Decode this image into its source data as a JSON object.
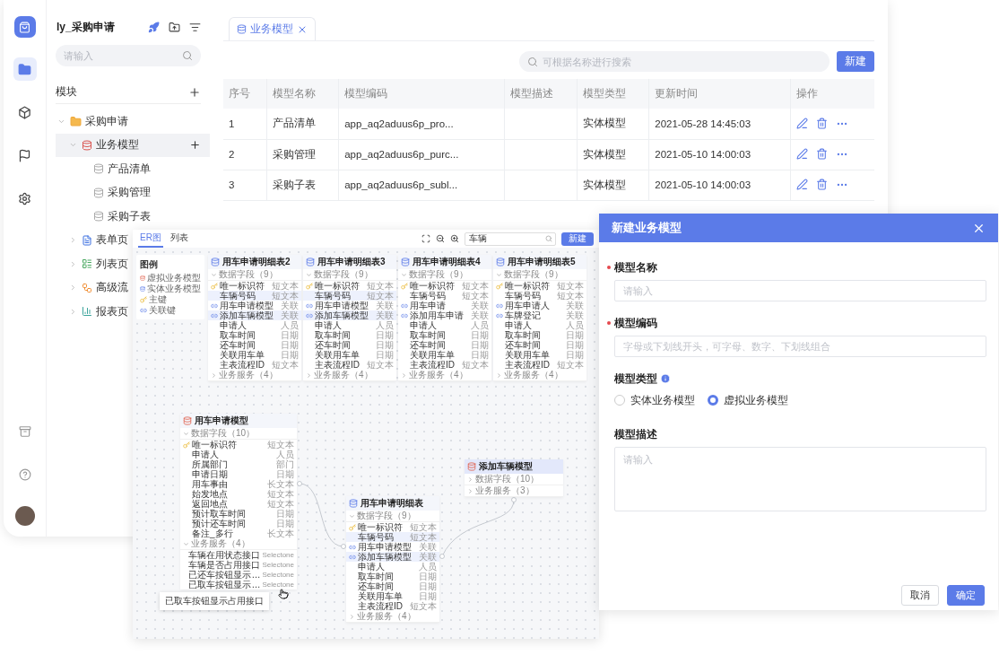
{
  "app_window": {
    "rail": {
      "items": [
        {
          "selected": true
        },
        {
          "selected": false
        },
        {
          "selected": false
        },
        {
          "selected": false
        }
      ]
    },
    "project_title": "ly_采购申请",
    "sidebar_search": {
      "placeholder": "请输入"
    },
    "module_header": "模块",
    "tree": [
      {
        "label": "采购申请",
        "kind": "folder",
        "selected": false,
        "expanded": true,
        "children": [
          {
            "label": "业务模型",
            "kind": "model",
            "selected": true,
            "expanded": true,
            "children": [
              {
                "label": "产品清单",
                "kind": "table",
                "selected": false
              },
              {
                "label": "采购管理",
                "kind": "table",
                "selected": false
              },
              {
                "label": "采购子表",
                "kind": "table",
                "selected": false
              }
            ]
          },
          {
            "label": "表单页",
            "kind": "form",
            "selected": false,
            "expanded": false
          },
          {
            "label": "列表页",
            "kind": "list",
            "selected": false,
            "expanded": false
          },
          {
            "label": "高级流",
            "kind": "flow",
            "selected": false,
            "expanded": false
          },
          {
            "label": "报表页",
            "kind": "report",
            "selected": false,
            "expanded": false
          }
        ]
      }
    ],
    "tabs": [
      {
        "label": "业务模型",
        "selected": true,
        "closable": true
      }
    ],
    "table_search": {
      "placeholder": "可根据名称进行搜索"
    },
    "new_button": "新建",
    "table": {
      "columns": [
        "序号",
        "模型名称",
        "模型编码",
        "模型描述",
        "模型类型",
        "更新时间",
        "操作"
      ],
      "rows": [
        {
          "index": "1",
          "name": "产品清单",
          "code": "app_aq2aduus6p_pro...",
          "type": "实体模型",
          "updated": "2021-05-28 14:45:03"
        },
        {
          "index": "2",
          "name": "采购管理",
          "code": "app_aq2aduus6p_purc...",
          "type": "实体模型",
          "updated": "2021-05-10 14:00:03"
        },
        {
          "index": "3",
          "name": "采购子表",
          "code": "app_aq2aduus6p_subl...",
          "type": "实体模型",
          "updated": "2021-05-10 14:00:03"
        }
      ]
    }
  },
  "er_window": {
    "tabs": [
      {
        "label": "ER图",
        "selected": true
      },
      {
        "label": "列表",
        "selected": false
      }
    ],
    "search": {
      "value": "车辆"
    },
    "new_button": "新建",
    "legend": {
      "title": "图例",
      "items": [
        {
          "label": "虚拟业务模型",
          "kind": "virtual"
        },
        {
          "label": "实体业务模型",
          "kind": "entity"
        },
        {
          "label": "主键",
          "kind": "key"
        },
        {
          "label": "关联键",
          "kind": "link"
        }
      ]
    },
    "entities": [
      {
        "name": "用车申请明细表2",
        "kind": "entity",
        "selected": false,
        "fields": {
          "label": "数据字段（9）",
          "expanded": true,
          "items": [
            {
              "name": "唯一标识符",
              "type": "短文本",
              "kind": "key",
              "highlighted": false
            },
            {
              "name": "车辆号码",
              "type": "短文本",
              "kind": "plain",
              "highlighted": true
            },
            {
              "name": "用车申请模型",
              "type": "关联",
              "kind": "link",
              "highlighted": false
            },
            {
              "name": "添加车辆模型",
              "type": "关联",
              "kind": "link",
              "highlighted": true
            },
            {
              "name": "申请人",
              "type": "人员",
              "kind": "plain",
              "highlighted": false
            },
            {
              "name": "取车时间",
              "type": "日期",
              "kind": "plain",
              "highlighted": false
            },
            {
              "name": "还车时间",
              "type": "日期",
              "kind": "plain",
              "highlighted": false
            },
            {
              "name": "关联用车单",
              "type": "日期",
              "kind": "plain",
              "highlighted": false
            },
            {
              "name": "主表流程ID",
              "type": "短文本",
              "kind": "plain",
              "highlighted": false
            }
          ]
        },
        "services": {
          "label": "业务服务（4）",
          "expanded": false
        }
      },
      {
        "name": "用车申请明细表3",
        "kind": "entity",
        "selected": false,
        "fields": {
          "label": "数据字段（9）",
          "expanded": true,
          "items": [
            {
              "name": "唯一标识符",
              "type": "短文本",
              "kind": "key",
              "highlighted": false
            },
            {
              "name": "车辆号码",
              "type": "短文本",
              "kind": "plain",
              "highlighted": true
            },
            {
              "name": "用车申请模型",
              "type": "关联",
              "kind": "link",
              "highlighted": false
            },
            {
              "name": "添加车辆模型",
              "type": "关联",
              "kind": "link",
              "highlighted": true
            },
            {
              "name": "申请人",
              "type": "人员",
              "kind": "plain",
              "highlighted": false
            },
            {
              "name": "取车时间",
              "type": "日期",
              "kind": "plain",
              "highlighted": false
            },
            {
              "name": "还车时间",
              "type": "日期",
              "kind": "plain",
              "highlighted": false
            },
            {
              "name": "关联用车单",
              "type": "日期",
              "kind": "plain",
              "highlighted": false
            },
            {
              "name": "主表流程ID",
              "type": "短文本",
              "kind": "plain",
              "highlighted": false
            }
          ]
        },
        "services": {
          "label": "业务服务（4）",
          "expanded": false
        }
      },
      {
        "name": "用车申请明细表4",
        "kind": "entity",
        "selected": false,
        "fields": {
          "label": "数据字段（9）",
          "expanded": true,
          "items": [
            {
              "name": "唯一标识符",
              "type": "短文本",
              "kind": "key",
              "highlighted": false
            },
            {
              "name": "车辆号码",
              "type": "短文本",
              "kind": "plain",
              "highlighted": false
            },
            {
              "name": "用车申请",
              "type": "关联",
              "kind": "link",
              "highlighted": false
            },
            {
              "name": "添加用车申请",
              "type": "关联",
              "kind": "link",
              "highlighted": false
            },
            {
              "name": "申请人",
              "type": "人员",
              "kind": "plain",
              "highlighted": false
            },
            {
              "name": "取车时间",
              "type": "日期",
              "kind": "plain",
              "highlighted": false
            },
            {
              "name": "还车时间",
              "type": "日期",
              "kind": "plain",
              "highlighted": false
            },
            {
              "name": "关联用车单",
              "type": "日期",
              "kind": "plain",
              "highlighted": false
            },
            {
              "name": "主表流程ID",
              "type": "短文本",
              "kind": "plain",
              "highlighted": false
            }
          ]
        },
        "services": {
          "label": "业务服务（4）",
          "expanded": false
        }
      },
      {
        "name": "用车申请明细表5",
        "kind": "entity",
        "selected": false,
        "fields": {
          "label": "数据字段（9）",
          "expanded": true,
          "items": [
            {
              "name": "唯一标识符",
              "type": "短文本",
              "kind": "key",
              "highlighted": false
            },
            {
              "name": "车辆号码",
              "type": "短文本",
              "kind": "plain",
              "highlighted": false
            },
            {
              "name": "用车申请人",
              "type": "关联",
              "kind": "link",
              "highlighted": false
            },
            {
              "name": "车牌登记",
              "type": "关联",
              "kind": "link",
              "highlighted": false
            },
            {
              "name": "申请人",
              "type": "人员",
              "kind": "plain",
              "highlighted": false
            },
            {
              "name": "取车时间",
              "type": "日期",
              "kind": "plain",
              "highlighted": false
            },
            {
              "name": "还车时间",
              "type": "日期",
              "kind": "plain",
              "highlighted": false
            },
            {
              "name": "关联用车单",
              "type": "日期",
              "kind": "plain",
              "highlighted": false
            },
            {
              "name": "主表流程ID",
              "type": "短文本",
              "kind": "plain",
              "highlighted": false
            }
          ]
        },
        "services": {
          "label": "业务服务（4）",
          "expanded": false
        }
      },
      {
        "name": "用车申请模型",
        "kind": "virtual",
        "selected": false,
        "fields": {
          "label": "数据字段（10）",
          "expanded": true,
          "items": [
            {
              "name": "唯一标识符",
              "type": "短文本",
              "kind": "key",
              "highlighted": false
            },
            {
              "name": "申请人",
              "type": "人员",
              "kind": "plain",
              "highlighted": false
            },
            {
              "name": "所属部门",
              "type": "部门",
              "kind": "plain",
              "highlighted": false
            },
            {
              "name": "申请日期",
              "type": "日期",
              "kind": "plain",
              "highlighted": false
            },
            {
              "name": "用车事由",
              "type": "长文本",
              "kind": "plain",
              "highlighted": false
            },
            {
              "name": "始发地点",
              "type": "短文本",
              "kind": "plain",
              "highlighted": false
            },
            {
              "name": "返回地点",
              "type": "短文本",
              "kind": "plain",
              "highlighted": false
            },
            {
              "name": "预计取车时间",
              "type": "日期",
              "kind": "plain",
              "highlighted": false
            },
            {
              "name": "预计还车时间",
              "type": "日期",
              "kind": "plain",
              "highlighted": false
            },
            {
              "name": "备注_多行",
              "type": "长文本",
              "kind": "plain",
              "highlighted": false
            }
          ]
        },
        "services": {
          "label": "业务服务（4）",
          "expanded": true,
          "items": [
            {
              "name": "车辆在用状态接口",
              "type": "Selectone"
            },
            {
              "name": "车辆是否占用接口",
              "type": "Selectone"
            },
            {
              "name": "已还车按钮显示…",
              "type": "Selectone"
            },
            {
              "name": "已取车按钮显示…",
              "type": "Selectone"
            }
          ]
        }
      },
      {
        "name": "用车申请明细表",
        "kind": "entity",
        "selected": false,
        "fields": {
          "label": "数据字段（9）",
          "expanded": true,
          "items": [
            {
              "name": "唯一标识符",
              "type": "短文本",
              "kind": "key",
              "highlighted": false
            },
            {
              "name": "车辆号码",
              "type": "短文本",
              "kind": "plain",
              "highlighted": true
            },
            {
              "name": "用车申请模型",
              "type": "关联",
              "kind": "link",
              "highlighted": false
            },
            {
              "name": "添加车辆模型",
              "type": "关联",
              "kind": "link",
              "highlighted": true
            },
            {
              "name": "申请人",
              "type": "人员",
              "kind": "plain",
              "highlighted": false
            },
            {
              "name": "取车时间",
              "type": "日期",
              "kind": "plain",
              "highlighted": false
            },
            {
              "name": "还车时间",
              "type": "日期",
              "kind": "plain",
              "highlighted": false
            },
            {
              "name": "关联用车单",
              "type": "日期",
              "kind": "plain",
              "highlighted": false
            },
            {
              "name": "主表流程ID",
              "type": "短文本",
              "kind": "plain",
              "highlighted": false
            }
          ]
        },
        "services": {
          "label": "业务服务（4）",
          "expanded": false
        }
      },
      {
        "name": "添加车辆模型",
        "kind": "virtual",
        "selected": true,
        "fields": {
          "label": "数据字段（10）",
          "expanded": false
        },
        "services": {
          "label": "业务服务（3）",
          "expanded": false
        }
      }
    ],
    "tooltip": "已取车按钮显示占用接口"
  },
  "dialog": {
    "title": "新建业务模型",
    "fields": [
      {
        "kind": "input",
        "label": "模型名称",
        "required": true,
        "placeholder": "请输入"
      },
      {
        "kind": "input",
        "label": "模型编码",
        "required": true,
        "placeholder": "字母或下划线开头，可字母、数字、下划线组合"
      },
      {
        "kind": "radio",
        "label": "模型类型",
        "required": false,
        "info": true,
        "options": [
          {
            "label": "实体业务模型",
            "selected": false
          },
          {
            "label": "虚拟业务模型",
            "selected": true
          }
        ]
      },
      {
        "kind": "textarea",
        "label": "模型描述",
        "required": false,
        "placeholder": "请输入"
      }
    ],
    "buttons": [
      {
        "label": "取消",
        "kind": "secondary"
      },
      {
        "label": "确定",
        "kind": "primary"
      }
    ]
  }
}
